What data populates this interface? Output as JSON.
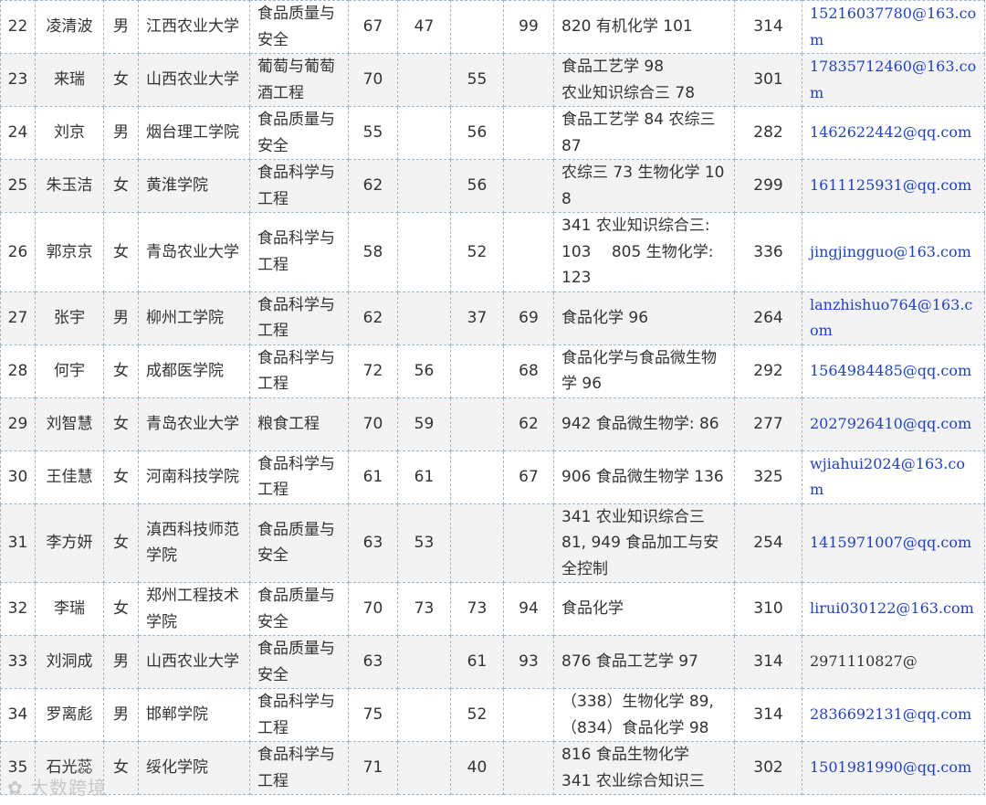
{
  "rows": [
    {
      "no": "22",
      "name": "凌清波",
      "gender": "男",
      "school": "江西农业大学",
      "major": "食品质量与安全",
      "s1": "67",
      "s2": "47",
      "s3": "",
      "s4": "99",
      "subjects": "820 有机化学 101",
      "total": "314",
      "email": "15216037780@163.com",
      "email_link": true
    },
    {
      "no": "23",
      "name": "来瑞",
      "gender": "女",
      "school": "山西农业大学",
      "major": "葡萄与葡萄酒工程",
      "s1": "70",
      "s2": "",
      "s3": "55",
      "s4": "",
      "subjects": "食品工艺学 98\n农业知识综合三 78",
      "total": "301",
      "email": "17835712460@163.com",
      "email_link": true
    },
    {
      "no": "24",
      "name": "刘京",
      "gender": "男",
      "school": "烟台理工学院",
      "major": "食品质量与安全",
      "s1": "55",
      "s2": "",
      "s3": "56",
      "s4": "",
      "subjects": "食品工艺学 84 农综三 87",
      "total": "282",
      "email": "1462622442@qq.com",
      "email_link": true
    },
    {
      "no": "25",
      "name": "朱玉洁",
      "gender": "女",
      "school": "黄淮学院",
      "major": "食品科学与工程",
      "s1": "62",
      "s2": "",
      "s3": "56",
      "s4": "",
      "subjects": "农综三 73 生物化学 108",
      "total": "299",
      "email": "1611125931@qq.com",
      "email_link": true
    },
    {
      "no": "26",
      "name": "郭京京",
      "gender": "女",
      "school": "青岛农业大学",
      "major": "食品科学与工程",
      "s1": "58",
      "s2": "",
      "s3": "52",
      "s4": "",
      "subjects": "341 农业知识综合三:\n103　 805 生物化学:\n123",
      "total": "336",
      "email": "jingjingguo@163.com",
      "email_link": true
    },
    {
      "no": "27",
      "name": "张宇",
      "gender": "男",
      "school": "柳州工学院",
      "major": "食品科学与工程",
      "s1": "62",
      "s2": "",
      "s3": "37",
      "s4": "69",
      "subjects": "食品化学 96",
      "total": "264",
      "email": "lanzhishuo764@163.com",
      "email_link": true
    },
    {
      "no": "28",
      "name": "何宇",
      "gender": "女",
      "school": "成都医学院",
      "major": "食品科学与工程",
      "s1": "72",
      "s2": "56",
      "s3": "",
      "s4": "68",
      "subjects": "食品化学与食品微生物学 96",
      "total": "292",
      "email": "1564984485@qq.com",
      "email_link": true
    },
    {
      "no": "29",
      "name": "刘智慧",
      "gender": "女",
      "school": "青岛农业大学",
      "major": "粮食工程",
      "s1": "70",
      "s2": "59",
      "s3": "",
      "s4": "62",
      "subjects": "942 食品微生物学: 86",
      "total": "277",
      "email": "2027926410@qq.com",
      "email_link": true
    },
    {
      "no": "30",
      "name": "王佳慧",
      "gender": "女",
      "school": "河南科技学院",
      "major": "食品科学与工程",
      "s1": "61",
      "s2": "61",
      "s3": "",
      "s4": "67",
      "subjects": "906 食品微生物学 136",
      "total": "325",
      "email": "wjiahui2024@163.com",
      "email_link": true
    },
    {
      "no": "31",
      "name": "李方妍",
      "gender": "女",
      "school": "滇西科技师范学院",
      "major": "食品质量与安全",
      "s1": "63",
      "s2": "53",
      "s3": "",
      "s4": "",
      "subjects": "341 农业知识综合三\n81, 949 食品加工与安\n全控制",
      "total": "254",
      "email": "1415971007@qq.com",
      "email_link": true
    },
    {
      "no": "32",
      "name": "李瑞",
      "gender": "女",
      "school": "郑州工程技术学院",
      "major": "食品质量与安全",
      "s1": "70",
      "s2": "73",
      "s3": "73",
      "s4": "94",
      "subjects": "食品化学",
      "total": "310",
      "email": "lirui030122@163.com",
      "email_link": true
    },
    {
      "no": "33",
      "name": "刘洞成",
      "gender": "男",
      "school": "山西农业大学",
      "major": "食品质量与安全",
      "s1": "63",
      "s2": "",
      "s3": "61",
      "s4": "93",
      "subjects": "876 食品工艺学 97",
      "total": "314",
      "email": "2971110827@",
      "email_link": false
    },
    {
      "no": "34",
      "name": "罗离彪",
      "gender": "男",
      "school": "邯郸学院",
      "major": "食品科学与工程",
      "s1": "75",
      "s2": "",
      "s3": "52",
      "s4": "",
      "subjects": "（338）生物化学 89,\n（834）食品化学 98",
      "total": "314",
      "email": "2836692131@qq.com",
      "email_link": true
    },
    {
      "no": "35",
      "name": "石光蕊",
      "gender": "女",
      "school": "绥化学院",
      "major": "食品科学与工程",
      "s1": "71",
      "s2": "",
      "s3": "40",
      "s4": "",
      "subjects": "816 食品生物化学\n341 农业综合知识三",
      "total": "302",
      "email": "1501981990@qq.com",
      "email_link": true
    }
  ],
  "watermark": "大数跨境",
  "colors": {
    "link": "#1d3fd0",
    "stripe": "#f3f3f3",
    "border": "#9fb7c9"
  }
}
